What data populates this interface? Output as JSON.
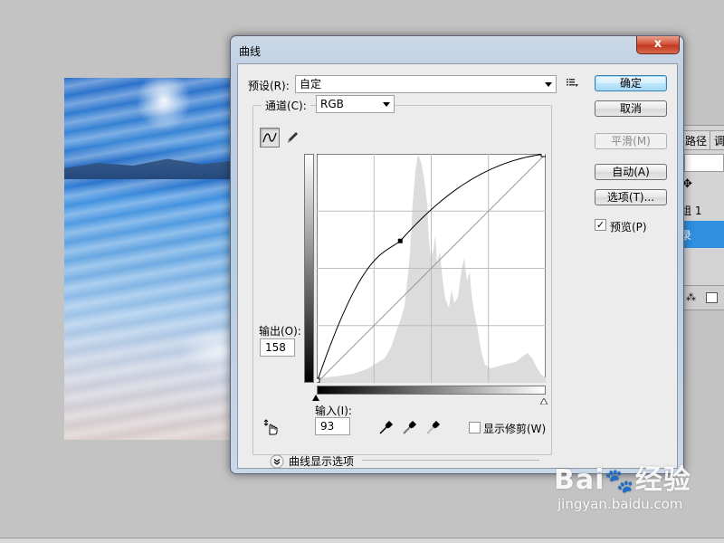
{
  "dialog": {
    "title": "曲线",
    "close_symbol": "x",
    "preset": {
      "label": "预设(R):",
      "value": "自定"
    },
    "channel": {
      "label": "通道(C):",
      "value": "RGB"
    },
    "buttons": {
      "ok": "确定",
      "cancel": "取消",
      "smooth": "平滑(M)",
      "auto": "自动(A)",
      "options": "选项(T)..."
    },
    "preview": {
      "label": "预览(P)",
      "checked": true
    },
    "output": {
      "label": "输出(O):",
      "value": "158"
    },
    "input": {
      "label": "输入(I):",
      "value": "93"
    },
    "show_clipping": {
      "label": "显示修剪(W)",
      "checked": false
    },
    "curve_display_options": "曲线显示选项",
    "curve_point": {
      "input": 93,
      "output": 158
    },
    "icons": {
      "preset_menu": "list-menu-icon",
      "curve_tool": "curve-tool-icon",
      "pencil_tool": "pencil-icon",
      "target_adjust": "hand-adjust-icon",
      "black_eyedropper": "eyedropper-black-icon",
      "gray_eyedropper": "eyedropper-gray-icon",
      "white_eyedropper": "eyedropper-white-icon",
      "expand": "chevron-down-circle-icon"
    }
  },
  "right_panel": {
    "tabs": [
      "路径",
      "调"
    ],
    "layer_label": "组 1",
    "selected_label": "录"
  },
  "watermark": {
    "brand_left": "Bai",
    "brand_right": "经验",
    "url": "jingyan.baidu.com"
  },
  "colors": {
    "dialog_frame": "#bfd0e2",
    "client_bg": "#ececec",
    "selection_blue": "#2f8fe0",
    "close_red": "#c13a22"
  }
}
